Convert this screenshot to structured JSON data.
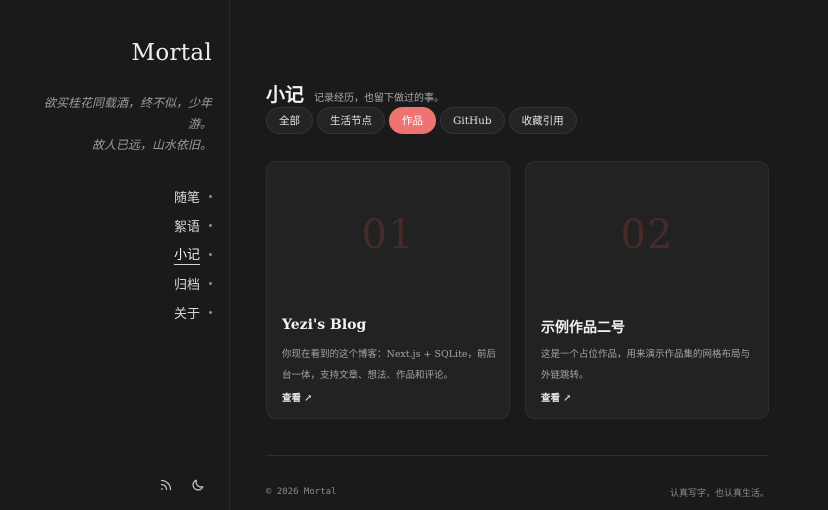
{
  "sidebar": {
    "site_title": "Mortal",
    "motto_line1": "欲买桂花同载酒，终不似，少年游。",
    "motto_line2": "故人已远，山水依旧。",
    "nav": [
      {
        "label": "随笔",
        "active": false
      },
      {
        "label": "絮语",
        "active": false
      },
      {
        "label": "小记",
        "active": true
      },
      {
        "label": "归档",
        "active": false
      },
      {
        "label": "关于",
        "active": false
      }
    ],
    "icons": [
      "rss-icon",
      "moon-icon"
    ]
  },
  "main": {
    "title": "小记",
    "subtitle": "记录经历，也留下做过的事。",
    "tabs": [
      {
        "label": "全部",
        "active": false
      },
      {
        "label": "生活节点",
        "active": false
      },
      {
        "label": "作品",
        "active": true
      },
      {
        "label": "GitHub",
        "active": false
      },
      {
        "label": "收藏引用",
        "active": false
      }
    ],
    "cards": [
      {
        "number": "01",
        "title": "Yezi's Blog",
        "desc": "你现在看到的这个博客：Next.js + SQLite，前后台一体，支持文章、想法、作品和评论。",
        "link": "查看 ↗"
      },
      {
        "number": "02",
        "title": "示例作品二号",
        "desc": "这是一个占位作品，用来演示作品集的网格布局与外链跳转。",
        "link": "查看 ↗"
      }
    ]
  },
  "footer": {
    "copyright": "© 2026 Mortal",
    "tagline": "认真写字，也认真生活。"
  },
  "colors": {
    "background": "#1a1a1a",
    "accent": "#ee7371",
    "card": "#222222"
  }
}
